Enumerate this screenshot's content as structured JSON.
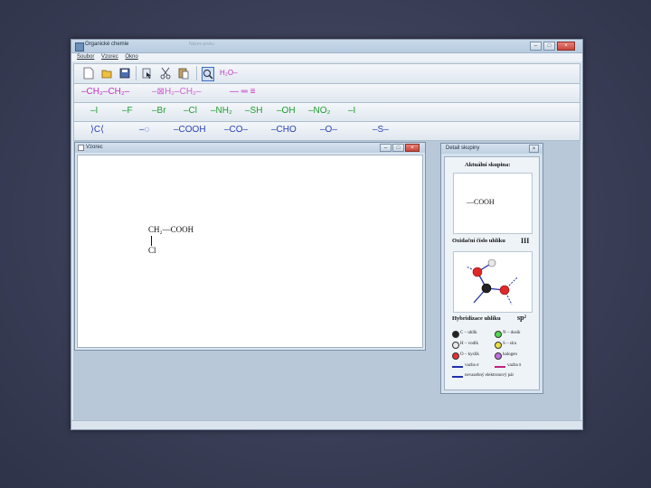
{
  "window": {
    "title": "Organické chemie",
    "ghost_title": "Název prvku",
    "minimize": "–",
    "maximize": "□",
    "close": "×"
  },
  "menu": [
    "Soubor",
    "Vzorec",
    "Okno"
  ],
  "toolbar": {
    "formula_label": "H₂O–"
  },
  "chains": {
    "ch2_ch2": "–CH₂–CH₂–",
    "ch2_ch2_disabled": "–⊠H₂–CH₂–",
    "bonds": "—  ═  ≡"
  },
  "groups_row1": [
    "–I",
    "–F",
    "–Br",
    "–Cl",
    "–NH₂",
    "–SH",
    "–OH",
    "–NO₂",
    "–I"
  ],
  "groups_row2": [
    "⟩C⟨",
    "–◌",
    "–COOH",
    "–CO–",
    "–CHO",
    "–O–",
    "–S–"
  ],
  "child_window": {
    "title": "Vzorec",
    "formula_top": "CH₂—COOH",
    "formula_bottom": "Cl"
  },
  "detail": {
    "title": "Detail skupiny",
    "close": "×",
    "current_group_label": "Aktuální skupina:",
    "current_group_value": "—COOH",
    "oxidation_label": "Oxidační číslo uhlíku",
    "oxidation_value": "III",
    "hybrid_label": "Hybridizace uhlíku",
    "hybrid_value": "sp²",
    "legend": [
      {
        "color": "#222222",
        "text": "C – uhlík"
      },
      {
        "color": "#4fd84f",
        "text": "N – dusík"
      },
      {
        "color": "#e8e8e8",
        "text": "H – vodík"
      },
      {
        "color": "#e8e040",
        "text": "S – síra"
      },
      {
        "color": "#e83030",
        "text": "O – kyslík"
      },
      {
        "color": "#c070e0",
        "text": "halogen"
      }
    ],
    "bond_legend": [
      {
        "text": "vazba σ",
        "color": "#2030b0"
      },
      {
        "text": "vazba π",
        "color": "#c02080"
      },
      {
        "text": "nevazebný elektronový pár",
        "color": "#2030b0"
      }
    ]
  }
}
